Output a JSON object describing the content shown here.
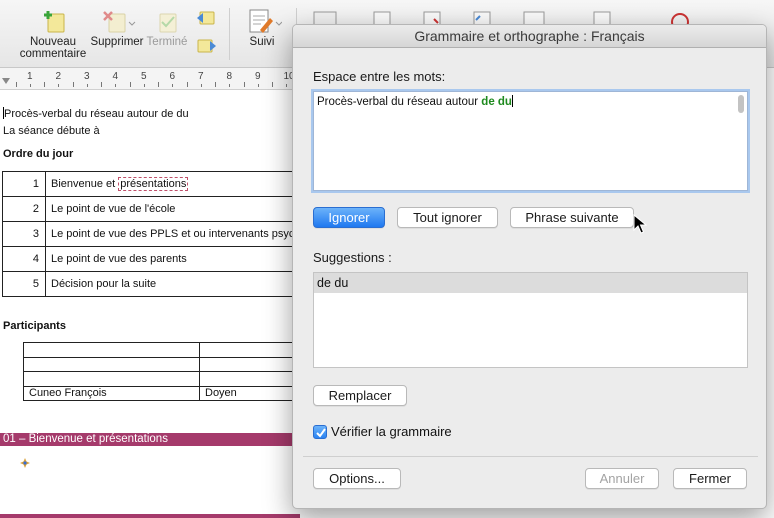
{
  "ribbon": {
    "new_comment_line1": "Nouveau",
    "new_comment_line2": "commentaire",
    "delete": "Supprimer",
    "done": "Terminé",
    "track": "Suivi"
  },
  "ruler": {
    "numbers": [
      "1",
      "2",
      "3",
      "4",
      "5",
      "6",
      "7",
      "8",
      "9",
      "10"
    ]
  },
  "document": {
    "line1": "Procès-verbal du réseau autour de  du",
    "line2": "La séance débute à",
    "agenda_heading": "Ordre du jour",
    "agenda": [
      {
        "num": "1",
        "before": "Bienvenue et ",
        "flagged": "présentations"
      },
      {
        "num": "2",
        "text": "Le point de vue de l'école"
      },
      {
        "num": "3",
        "text": "Le point de vue des PPLS et ou intervenants psyc"
      },
      {
        "num": "4",
        "text": "Le point de vue des parents"
      },
      {
        "num": "5",
        "text": "Décision pour la suite"
      }
    ],
    "participants_heading": "Participants",
    "participant_name": "Cuneo François",
    "participant_role": "Doyen",
    "section_heading": "01 – Bienvenue et présentations"
  },
  "dialog": {
    "title": "Grammaire et orthographe : Français",
    "issue_label": "Espace entre les mots:",
    "sentence_before": "Procès-verbal du réseau autour ",
    "sentence_highlight": "de  du",
    "ignore_button": "Ignorer",
    "ignore_all_button": "Tout ignorer",
    "next_sentence_button": "Phrase suivante",
    "suggestions_label": "Suggestions :",
    "suggestions": [
      "de du"
    ],
    "replace_button": "Remplacer",
    "check_grammar_label": "Vérifier la grammaire",
    "check_grammar_checked": true,
    "options_button": "Options...",
    "undo_button": "Annuler",
    "close_button": "Fermer"
  },
  "colors": {
    "accent": "#1f78f0",
    "highlight_text": "#1e8a1e",
    "heading_bar": "#a53a6b",
    "error_underline": "#c0506a"
  }
}
